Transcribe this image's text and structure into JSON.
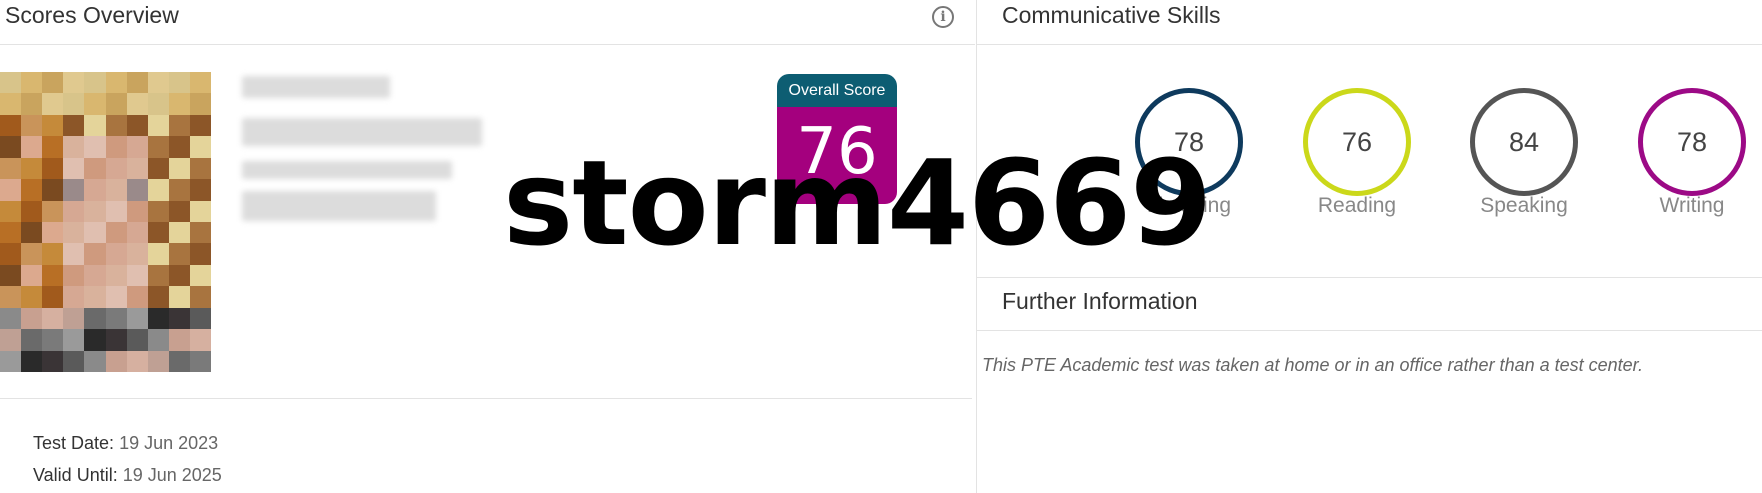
{
  "scores_overview": {
    "title": "Scores Overview",
    "info_icon": "info-icon",
    "overall_score_label": "Overall Score",
    "overall_score_value": "76",
    "test_date_label": "Test Date:",
    "test_date_value": "19 Jun 2023",
    "valid_until_label": "Valid Until:",
    "valid_until_value": "19 Jun 2025"
  },
  "watermark": "storm4669",
  "communicative_skills": {
    "title": "Communicative Skills",
    "skills": [
      {
        "label": "Listening",
        "score": "78",
        "color": "#0e3a5d"
      },
      {
        "label": "Reading",
        "score": "76",
        "color": "#cbd81a"
      },
      {
        "label": "Speaking",
        "score": "84",
        "color": "#555555"
      },
      {
        "label": "Writing",
        "score": "78",
        "color": "#9c0a86"
      }
    ]
  },
  "further_information": {
    "title": "Further Information",
    "note": "This PTE Academic test was taken at home or in an office rather than a test center."
  },
  "colors": {
    "badge_header": "#0d5d72",
    "badge_body": "#a4007e"
  }
}
